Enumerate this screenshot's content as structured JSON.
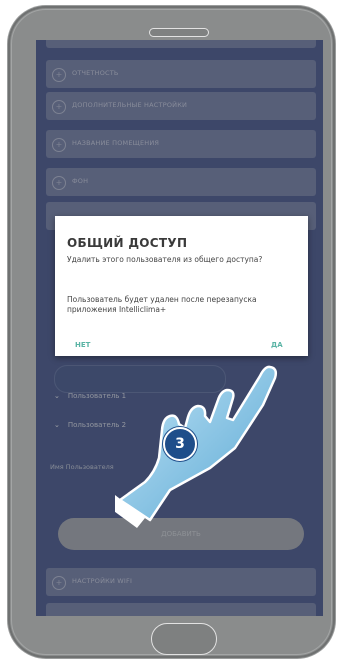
{
  "settings_rows": [
    {
      "label": "ОТЧЕТНОСТЬ"
    },
    {
      "label": "ДОПОЛНИТЕЛЬНЫЕ НАСТРОЙКИ"
    },
    {
      "label": "НАЗВАНИЕ ПОМЕЩЕНИЯ"
    },
    {
      "label": "ФОН"
    },
    {
      "label": "НАСТРОЙКИ WIFI"
    }
  ],
  "users": [
    "Пользователь 1",
    "Пользователь 2"
  ],
  "field_label": "Имя Пользователя",
  "add_button": "ДОБАВИТЬ",
  "dialog": {
    "title": "ОБЩИЙ ДОСТУП",
    "message": "Удалить этого пользователя из общего доступа?",
    "note": "Пользователь будет удален после перезапуска приложения Intelliclima+",
    "no": "НЕТ",
    "yes": "ДА"
  },
  "step_number": "3",
  "colors": {
    "screen_bg": "#3e4e86",
    "accent": "#5ab4a5",
    "step_badge": "#1f4e8a"
  }
}
